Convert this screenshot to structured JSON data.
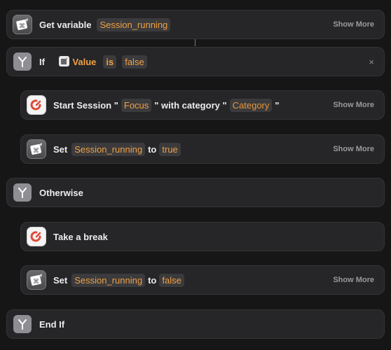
{
  "colors": {
    "background": "#161617",
    "card": "#262628",
    "accent": "#f0a044"
  },
  "actions": {
    "get_variable": {
      "label": "Get variable",
      "variable": "Session_running",
      "more": "Show More"
    },
    "if_block": {
      "label": "If",
      "value_token": "Value",
      "operator": "is",
      "compare_value": "false",
      "close_icon": "×"
    },
    "start_session": {
      "label": "Start Session \"",
      "focus": "Focus",
      "with_category": "\" with category \"",
      "category": "Category",
      "closing_quote": "\"",
      "more": "Show More"
    },
    "set_true": {
      "label": "Set",
      "variable": "Session_running",
      "to_label": "to",
      "value": "true",
      "more": "Show More"
    },
    "otherwise": {
      "label": "Otherwise"
    },
    "take_break": {
      "label": "Take a break"
    },
    "set_false": {
      "label": "Set",
      "variable": "Session_running",
      "to_label": "to",
      "value": "false",
      "more": "Show More"
    },
    "end_if": {
      "label": "End If"
    }
  }
}
